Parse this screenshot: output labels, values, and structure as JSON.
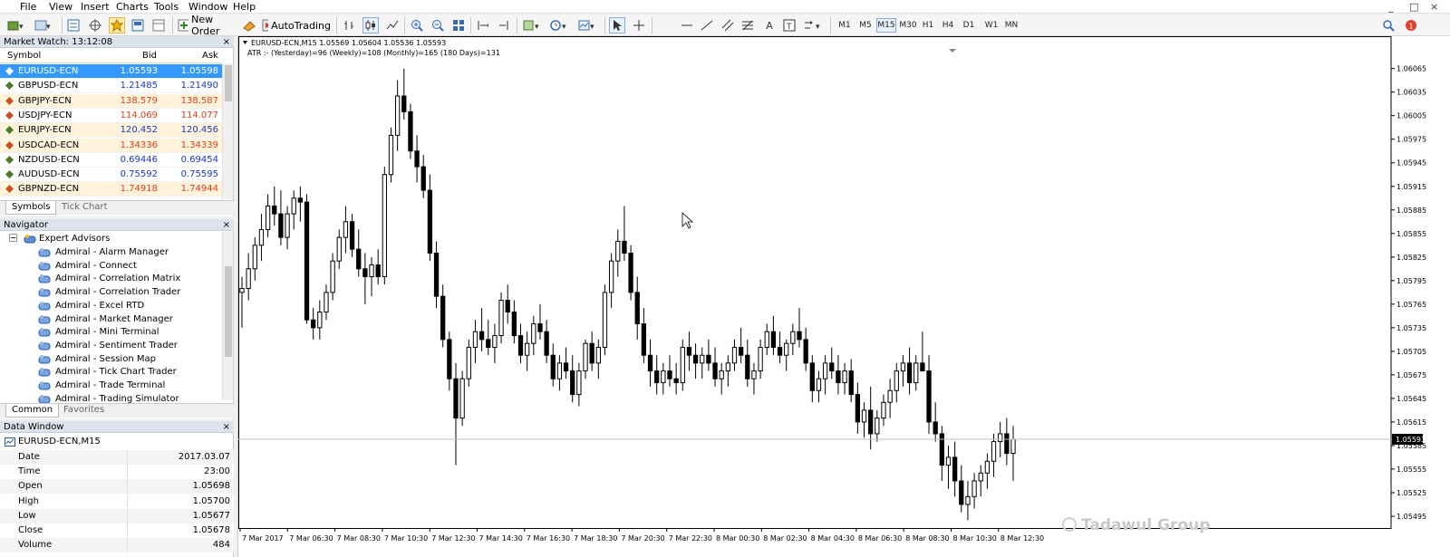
{
  "menu": [
    "File",
    "View",
    "Insert",
    "Charts",
    "Tools",
    "Window",
    "Help"
  ],
  "window_controls": [
    "_",
    "□",
    "×"
  ],
  "toolbar": {
    "new_order": "New Order",
    "auto_trading": "AutoTrading",
    "timeframes": [
      "M1",
      "M5",
      "M15",
      "M30",
      "H1",
      "H4",
      "D1",
      "W1",
      "MN"
    ],
    "active_timeframe": "M15"
  },
  "market_watch": {
    "title": "Market Watch: 13:12:08",
    "columns": {
      "symbol": "Symbol",
      "bid": "Bid",
      "ask": "Ask"
    },
    "rows": [
      {
        "symbol": "EURUSD-ECN",
        "bid": "1.05593",
        "ask": "1.05598",
        "color": "#ffffff",
        "state": "selected"
      },
      {
        "symbol": "GBPUSD-ECN",
        "bid": "1.21485",
        "ask": "1.21490",
        "color": "#1a35c7",
        "state": "normal"
      },
      {
        "symbol": "GBPJPY-ECN",
        "bid": "138.579",
        "ask": "138.587",
        "color": "#e03b14",
        "state": "highlight"
      },
      {
        "symbol": "USDJPY-ECN",
        "bid": "114.069",
        "ask": "114.077",
        "color": "#e03b14",
        "state": "normal"
      },
      {
        "symbol": "EURJPY-ECN",
        "bid": "120.452",
        "ask": "120.456",
        "color": "#1a35c7",
        "state": "highlight"
      },
      {
        "symbol": "USDCAD-ECN",
        "bid": "1.34336",
        "ask": "1.34339",
        "color": "#e03b14",
        "state": "highlight"
      },
      {
        "symbol": "NZDUSD-ECN",
        "bid": "0.69446",
        "ask": "0.69454",
        "color": "#1a35c7",
        "state": "normal"
      },
      {
        "symbol": "AUDUSD-ECN",
        "bid": "0.75592",
        "ask": "0.75595",
        "color": "#1a35c7",
        "state": "normal"
      },
      {
        "symbol": "GBPNZD-ECN",
        "bid": "1.74918",
        "ask": "1.74944",
        "color": "#e03b14",
        "state": "highlight"
      }
    ],
    "tabs": [
      "Symbols",
      "Tick Chart"
    ]
  },
  "navigator": {
    "title": "Navigator",
    "root": "Expert Advisors",
    "items": [
      "Admiral - Alarm Manager",
      "Admiral - Connect",
      "Admiral - Correlation Matrix",
      "Admiral - Correlation Trader",
      "Admiral - Excel RTD",
      "Admiral - Market Manager",
      "Admiral - Mini Terminal",
      "Admiral - Sentiment Trader",
      "Admiral - Session Map",
      "Admiral - Tick Chart Trader",
      "Admiral - Trade Terminal",
      "Admiral - Trading Simulator"
    ],
    "tabs": [
      "Common",
      "Favorites"
    ]
  },
  "data_window": {
    "title": "Data Window",
    "symbol": "EURUSD-ECN,M15",
    "rows": [
      {
        "key": "Date",
        "value": "2017.03.07"
      },
      {
        "key": "Time",
        "value": "23:00"
      },
      {
        "key": "Open",
        "value": "1.05698"
      },
      {
        "key": "High",
        "value": "1.05700"
      },
      {
        "key": "Low",
        "value": "1.05677"
      },
      {
        "key": "Close",
        "value": "1.05678"
      },
      {
        "key": "Volume",
        "value": "484"
      }
    ]
  },
  "chart": {
    "header": "EURUSD-ECN,M15  1.05569 1.05604 1.05536 1.05593",
    "atr_line": "ATR :- (Yesterday)=96       (Weekly)=108       (Monthly)=165       (180 Days)=131",
    "price_labels": [
      "1.06065",
      "1.06035",
      "1.06005",
      "1.05975",
      "1.05945",
      "1.05915",
      "1.05885",
      "1.05855",
      "1.05825",
      "1.05795",
      "1.05765",
      "1.05735",
      "1.05705",
      "1.05675",
      "1.05645",
      "1.05615",
      "1.05585",
      "1.05555",
      "1.05525",
      "1.05495"
    ],
    "current_price": "1.05593",
    "time_labels": [
      "7 Mar 2017",
      "7 Mar 06:30",
      "7 Mar 08:30",
      "7 Mar 10:30",
      "7 Mar 12:30",
      "7 Mar 14:30",
      "7 Mar 16:30",
      "7 Mar 18:30",
      "7 Mar 20:30",
      "7 Mar 22:30",
      "8 Mar 00:30",
      "8 Mar 02:30",
      "8 Mar 04:30",
      "8 Mar 06:30",
      "8 Mar 08:30",
      "8 Mar 10:30",
      "8 Mar 12:30"
    ],
    "watermark": "Tadawul Group"
  },
  "chart_data": {
    "type": "candlestick",
    "symbol": "EURUSD-ECN",
    "timeframe": "M15",
    "ylim": [
      1.0548,
      1.0609
    ],
    "candles": [
      [
        1.0578,
        1.058,
        1.05735,
        1.05785
      ],
      [
        1.05785,
        1.0583,
        1.0577,
        1.0581
      ],
      [
        1.0581,
        1.0585,
        1.05795,
        1.0584
      ],
      [
        1.0584,
        1.0588,
        1.0582,
        1.0586
      ],
      [
        1.0586,
        1.05905,
        1.0585,
        1.0589
      ],
      [
        1.0589,
        1.05915,
        1.05865,
        1.0588
      ],
      [
        1.0588,
        1.0591,
        1.0584,
        1.0585
      ],
      [
        1.0585,
        1.0589,
        1.05835,
        1.0588
      ],
      [
        1.0588,
        1.0591,
        1.0586,
        1.059
      ],
      [
        1.059,
        1.05915,
        1.0587,
        1.05895
      ],
      [
        1.05895,
        1.05905,
        1.0574,
        1.05745
      ],
      [
        1.05745,
        1.0576,
        1.0572,
        1.05735
      ],
      [
        1.05735,
        1.0577,
        1.0572,
        1.05755
      ],
      [
        1.05755,
        1.0579,
        1.05745,
        1.0578
      ],
      [
        1.0578,
        1.0583,
        1.0577,
        1.0582
      ],
      [
        1.0582,
        1.0586,
        1.0581,
        1.0585
      ],
      [
        1.0585,
        1.0589,
        1.0583,
        1.0587
      ],
      [
        1.0587,
        1.0588,
        1.05825,
        1.05835
      ],
      [
        1.05835,
        1.0586,
        1.058,
        1.0581
      ],
      [
        1.0581,
        1.0583,
        1.05765,
        1.058
      ],
      [
        1.058,
        1.05825,
        1.05775,
        1.05815
      ],
      [
        1.05815,
        1.05835,
        1.0579,
        1.058
      ],
      [
        1.058,
        1.0594,
        1.0579,
        1.0593
      ],
      [
        1.0593,
        1.0599,
        1.0592,
        1.0598
      ],
      [
        1.0598,
        1.0605,
        1.0596,
        1.0603
      ],
      [
        1.0603,
        1.06065,
        1.06,
        1.0601
      ],
      [
        1.0601,
        1.0602,
        1.0595,
        1.0596
      ],
      [
        1.0596,
        1.0598,
        1.0592,
        1.0594
      ],
      [
        1.0594,
        1.05955,
        1.059,
        1.0591
      ],
      [
        1.0591,
        1.0593,
        1.0582,
        1.0583
      ],
      [
        1.0583,
        1.05845,
        1.0576,
        1.05775
      ],
      [
        1.05775,
        1.0579,
        1.0571,
        1.0572
      ],
      [
        1.0572,
        1.0573,
        1.05655,
        1.0567
      ],
      [
        1.0567,
        1.0569,
        1.0556,
        1.0562
      ],
      [
        1.0562,
        1.0568,
        1.0561,
        1.0567
      ],
      [
        1.0567,
        1.0572,
        1.0566,
        1.0571
      ],
      [
        1.0571,
        1.05745,
        1.0569,
        1.0573
      ],
      [
        1.0573,
        1.0576,
        1.05705,
        1.0572
      ],
      [
        1.0572,
        1.05745,
        1.057,
        1.0571
      ],
      [
        1.0571,
        1.0574,
        1.0569,
        1.05725
      ],
      [
        1.05725,
        1.0578,
        1.05715,
        1.0577
      ],
      [
        1.0577,
        1.0579,
        1.0574,
        1.05755
      ],
      [
        1.05755,
        1.0577,
        1.05715,
        1.05725
      ],
      [
        1.05725,
        1.0574,
        1.0569,
        1.057
      ],
      [
        1.057,
        1.0573,
        1.0568,
        1.05715
      ],
      [
        1.05715,
        1.0575,
        1.057,
        1.0574
      ],
      [
        1.0574,
        1.05765,
        1.0572,
        1.0573
      ],
      [
        1.0573,
        1.05745,
        1.0569,
        1.057
      ],
      [
        1.057,
        1.05715,
        1.0566,
        1.0567
      ],
      [
        1.0567,
        1.057,
        1.05655,
        1.0569
      ],
      [
        1.0569,
        1.0571,
        1.0567,
        1.0568
      ],
      [
        1.0568,
        1.057,
        1.0564,
        1.0565
      ],
      [
        1.0565,
        1.0569,
        1.05635,
        1.0568
      ],
      [
        1.0568,
        1.0572,
        1.0567,
        1.05715
      ],
      [
        1.05715,
        1.0573,
        1.0568,
        1.0569
      ],
      [
        1.0569,
        1.0572,
        1.0567,
        1.0571
      ],
      [
        1.0571,
        1.0579,
        1.057,
        1.0578
      ],
      [
        1.0578,
        1.0583,
        1.0576,
        1.0582
      ],
      [
        1.0582,
        1.0586,
        1.058,
        1.05845
      ],
      [
        1.05845,
        1.0589,
        1.0582,
        1.0583
      ],
      [
        1.0583,
        1.0584,
        1.0577,
        1.0578
      ],
      [
        1.0578,
        1.058,
        1.0572,
        1.0574
      ],
      [
        1.0574,
        1.0576,
        1.0569,
        1.057
      ],
      [
        1.057,
        1.0572,
        1.0566,
        1.0568
      ],
      [
        1.0568,
        1.057,
        1.0565,
        1.05665
      ],
      [
        1.05665,
        1.0569,
        1.0565,
        1.0568
      ],
      [
        1.0568,
        1.057,
        1.0566,
        1.0567
      ],
      [
        1.0567,
        1.0569,
        1.0565,
        1.05665
      ],
      [
        1.05665,
        1.0572,
        1.05655,
        1.0571
      ],
      [
        1.0571,
        1.0573,
        1.0568,
        1.057
      ],
      [
        1.057,
        1.05715,
        1.0567,
        1.0569
      ],
      [
        1.0569,
        1.0571,
        1.0567,
        1.057
      ],
      [
        1.057,
        1.0572,
        1.0568,
        1.0569
      ],
      [
        1.0569,
        1.0571,
        1.0566,
        1.0567
      ],
      [
        1.0567,
        1.0569,
        1.0565,
        1.0568
      ],
      [
        1.0568,
        1.057,
        1.0566,
        1.0569
      ],
      [
        1.0569,
        1.0572,
        1.0568,
        1.0571
      ],
      [
        1.0571,
        1.05735,
        1.0569,
        1.057
      ],
      [
        1.057,
        1.0572,
        1.0566,
        1.0567
      ],
      [
        1.0567,
        1.0569,
        1.0565,
        1.0568
      ],
      [
        1.0568,
        1.0572,
        1.0567,
        1.0571
      ],
      [
        1.0571,
        1.0574,
        1.057,
        1.0573
      ],
      [
        1.0573,
        1.0575,
        1.057,
        1.0571
      ],
      [
        1.0571,
        1.0573,
        1.0569,
        1.057
      ],
      [
        1.057,
        1.0572,
        1.0568,
        1.05715
      ],
      [
        1.05715,
        1.0574,
        1.057,
        1.0573
      ],
      [
        1.0573,
        1.0576,
        1.0571,
        1.0572
      ],
      [
        1.0572,
        1.05735,
        1.0568,
        1.0569
      ],
      [
        1.0569,
        1.057,
        1.0564,
        1.05655
      ],
      [
        1.05655,
        1.0568,
        1.0564,
        1.0567
      ],
      [
        1.0567,
        1.057,
        1.0565,
        1.0569
      ],
      [
        1.0569,
        1.0571,
        1.0567,
        1.0568
      ],
      [
        1.0568,
        1.057,
        1.0565,
        1.05665
      ],
      [
        1.05665,
        1.0569,
        1.0565,
        1.0568
      ],
      [
        1.0568,
        1.05695,
        1.0564,
        1.0565
      ],
      [
        1.0565,
        1.05665,
        1.056,
        1.05615
      ],
      [
        1.05615,
        1.0564,
        1.05595,
        1.0563
      ],
      [
        1.0563,
        1.0566,
        1.0558,
        1.056
      ],
      [
        1.056,
        1.0563,
        1.0559,
        1.0562
      ],
      [
        1.0562,
        1.0565,
        1.0561,
        1.0564
      ],
      [
        1.0564,
        1.0567,
        1.0562,
        1.05655
      ],
      [
        1.05655,
        1.0569,
        1.0564,
        1.0568
      ],
      [
        1.0568,
        1.057,
        1.0566,
        1.0569
      ],
      [
        1.0569,
        1.0571,
        1.0565,
        1.05665
      ],
      [
        1.05665,
        1.057,
        1.05655,
        1.0569
      ],
      [
        1.0569,
        1.0573,
        1.0568,
        1.0568
      ],
      [
        1.0568,
        1.057,
        1.056,
        1.05615
      ],
      [
        1.05615,
        1.0564,
        1.0559,
        1.056
      ],
      [
        1.056,
        1.0561,
        1.0554,
        1.0556
      ],
      [
        1.0556,
        1.05585,
        1.0553,
        1.0557
      ],
      [
        1.0557,
        1.0559,
        1.0552,
        1.0554
      ],
      [
        1.0554,
        1.0556,
        1.055,
        1.0551
      ],
      [
        1.0551,
        1.0554,
        1.0549,
        1.0552
      ],
      [
        1.0552,
        1.0555,
        1.05505,
        1.0554
      ],
      [
        1.0554,
        1.0556,
        1.0552,
        1.0555
      ],
      [
        1.0555,
        1.05575,
        1.0553,
        1.05565
      ],
      [
        1.05565,
        1.056,
        1.05545,
        1.0559
      ],
      [
        1.0559,
        1.05615,
        1.0557,
        1.056
      ],
      [
        1.056,
        1.0562,
        1.0556,
        1.05575
      ],
      [
        1.05575,
        1.0561,
        1.0554,
        1.05593
      ]
    ]
  }
}
